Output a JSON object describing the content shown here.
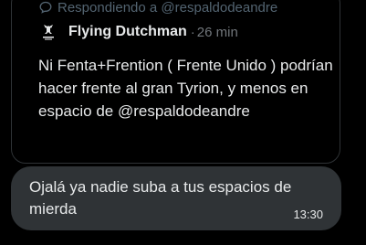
{
  "quoted_tweet": {
    "reply_context": "Respondiendo a @respaldodeandre",
    "author_name": "Flying Dutchman",
    "separator": "·",
    "relative_time": "26 min",
    "text": "Ni Fenta+Frention ( Frente Unido ) podrían hacer frente al gran Tyrion, y menos en espacio de @respaldodeandre"
  },
  "message": {
    "text": "Ojalá ya nadie suba a tus espacios de mierda",
    "time": "13:30"
  },
  "colors": {
    "background": "#000000",
    "bubble": "#2f3336",
    "text_primary": "#e7e9ea",
    "text_secondary": "#71767b",
    "border": "#2f3336"
  },
  "icons": {
    "reply": "speech-bubble-icon",
    "avatar": "flying-dutchman-avatar"
  }
}
